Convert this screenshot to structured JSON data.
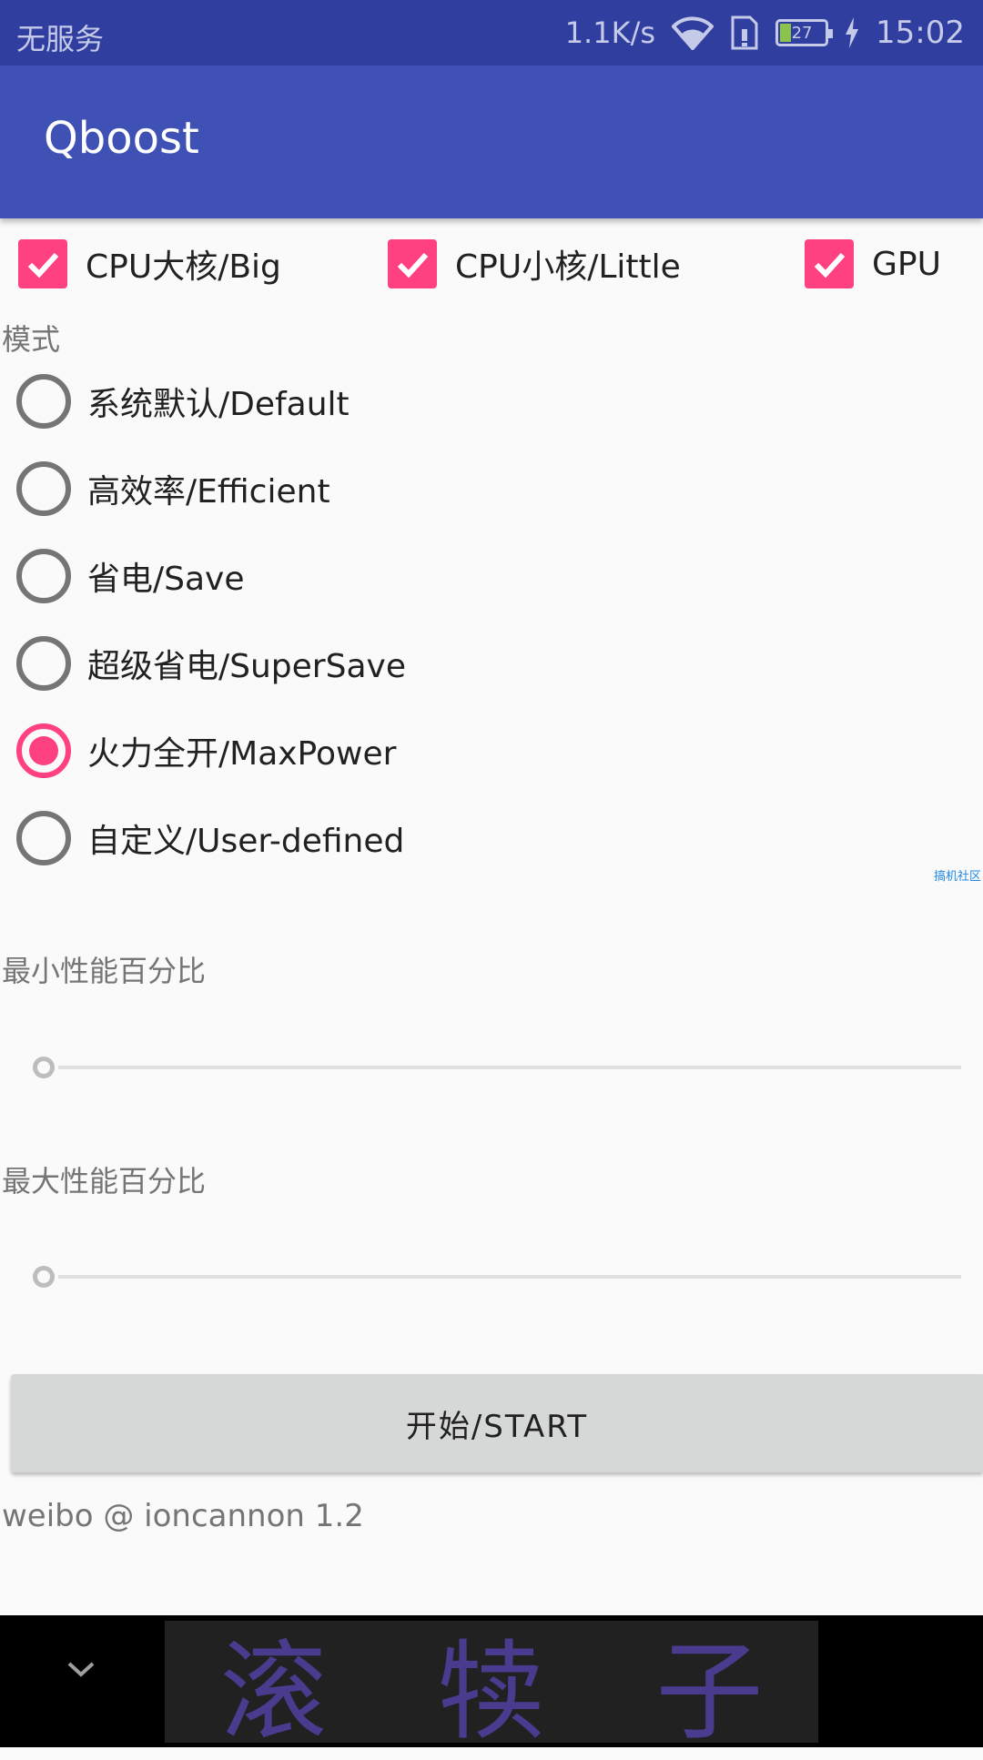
{
  "status_bar": {
    "carrier": "无服务",
    "net_speed": "1.1K/s",
    "battery_level": "27",
    "time": "15:02"
  },
  "app_bar": {
    "title": "Qboost"
  },
  "cores": [
    {
      "label": "CPU大核/Big",
      "checked": true
    },
    {
      "label": "CPU小核/Little",
      "checked": true
    },
    {
      "label": "GPU",
      "checked": true
    }
  ],
  "mode": {
    "label": "模式",
    "options": [
      {
        "label": "系统默认/Default",
        "selected": false
      },
      {
        "label": "高效率/Efficient",
        "selected": false
      },
      {
        "label": "省电/Save",
        "selected": false
      },
      {
        "label": "超级省电/SuperSave",
        "selected": false
      },
      {
        "label": "火力全开/MaxPower",
        "selected": true
      },
      {
        "label": "自定义/User-defined",
        "selected": false
      }
    ]
  },
  "watermark": "搞机社区",
  "min_perf": {
    "label": "最小性能百分比",
    "value": 0
  },
  "max_perf": {
    "label": "最大性能百分比",
    "value": 0
  },
  "start_button": "开始/START",
  "footer": "weibo @ ioncannon 1.2",
  "nav_banner": {
    "chars": [
      "滚",
      "犊",
      "子"
    ]
  },
  "colors": {
    "primary": "#3f51b5",
    "primary_dark": "#303f9f",
    "accent": "#ff4081"
  }
}
